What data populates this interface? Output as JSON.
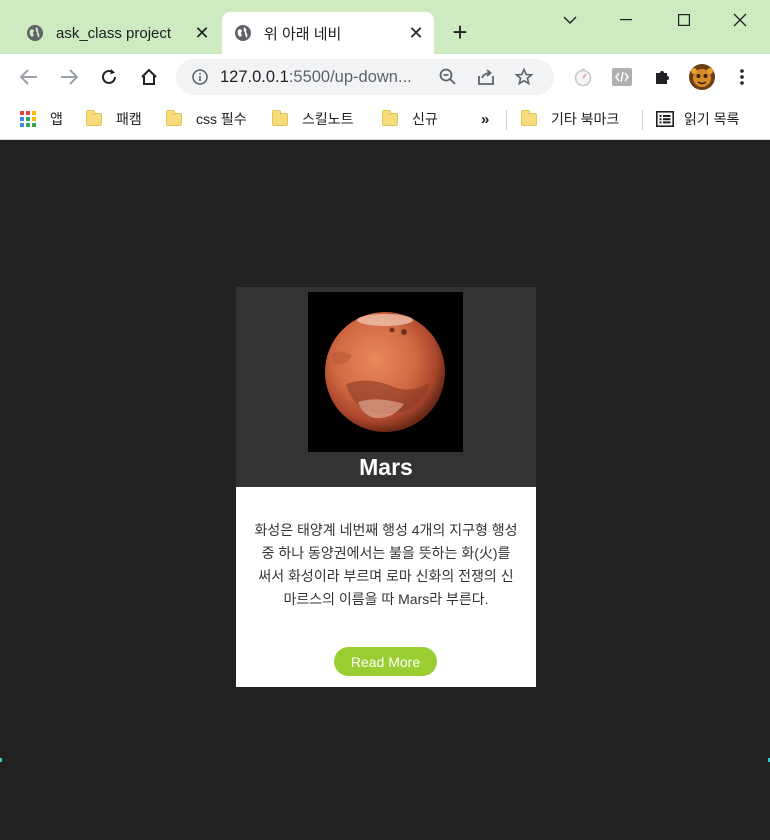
{
  "browser": {
    "tabs": [
      {
        "title": "ask_class project",
        "active": false
      },
      {
        "title": "위 아래 네비",
        "active": true
      }
    ],
    "address_bar": {
      "host": "127.0.0.1",
      "path": ":5500/up-down...",
      "favicon": "info-icon"
    },
    "bookmarks": [
      {
        "label": "앱",
        "icon": "apps-grid-icon"
      },
      {
        "label": "패캠",
        "icon": "folder-icon"
      },
      {
        "label": "css 필수",
        "icon": "folder-icon"
      },
      {
        "label": "스킬노트",
        "icon": "folder-icon"
      },
      {
        "label": "신규",
        "icon": "folder-icon"
      },
      {
        "label": "»",
        "icon": "chevron-double-right"
      },
      {
        "label": "기타 북마크",
        "icon": "folder-icon"
      },
      {
        "label": "읽기 목록",
        "icon": "reading-list-icon"
      }
    ],
    "colors": {
      "titlebar": "#cdeac0",
      "page_bg": "#222222"
    }
  },
  "card": {
    "title": "Mars",
    "description": "화성은 태양계 네번째 행성 4개의 지구형 행성중 하나 동양권에서는 불을 뜻하는 화(火)를 써서 화성이라 부르며 로마 신화의 전쟁의 신 마르스의 이름을 따 Mars라 부른다.",
    "button_label": "Read More",
    "colors": {
      "top": "#333333",
      "bottom": "#ffffff",
      "button": "#9acd32"
    }
  }
}
